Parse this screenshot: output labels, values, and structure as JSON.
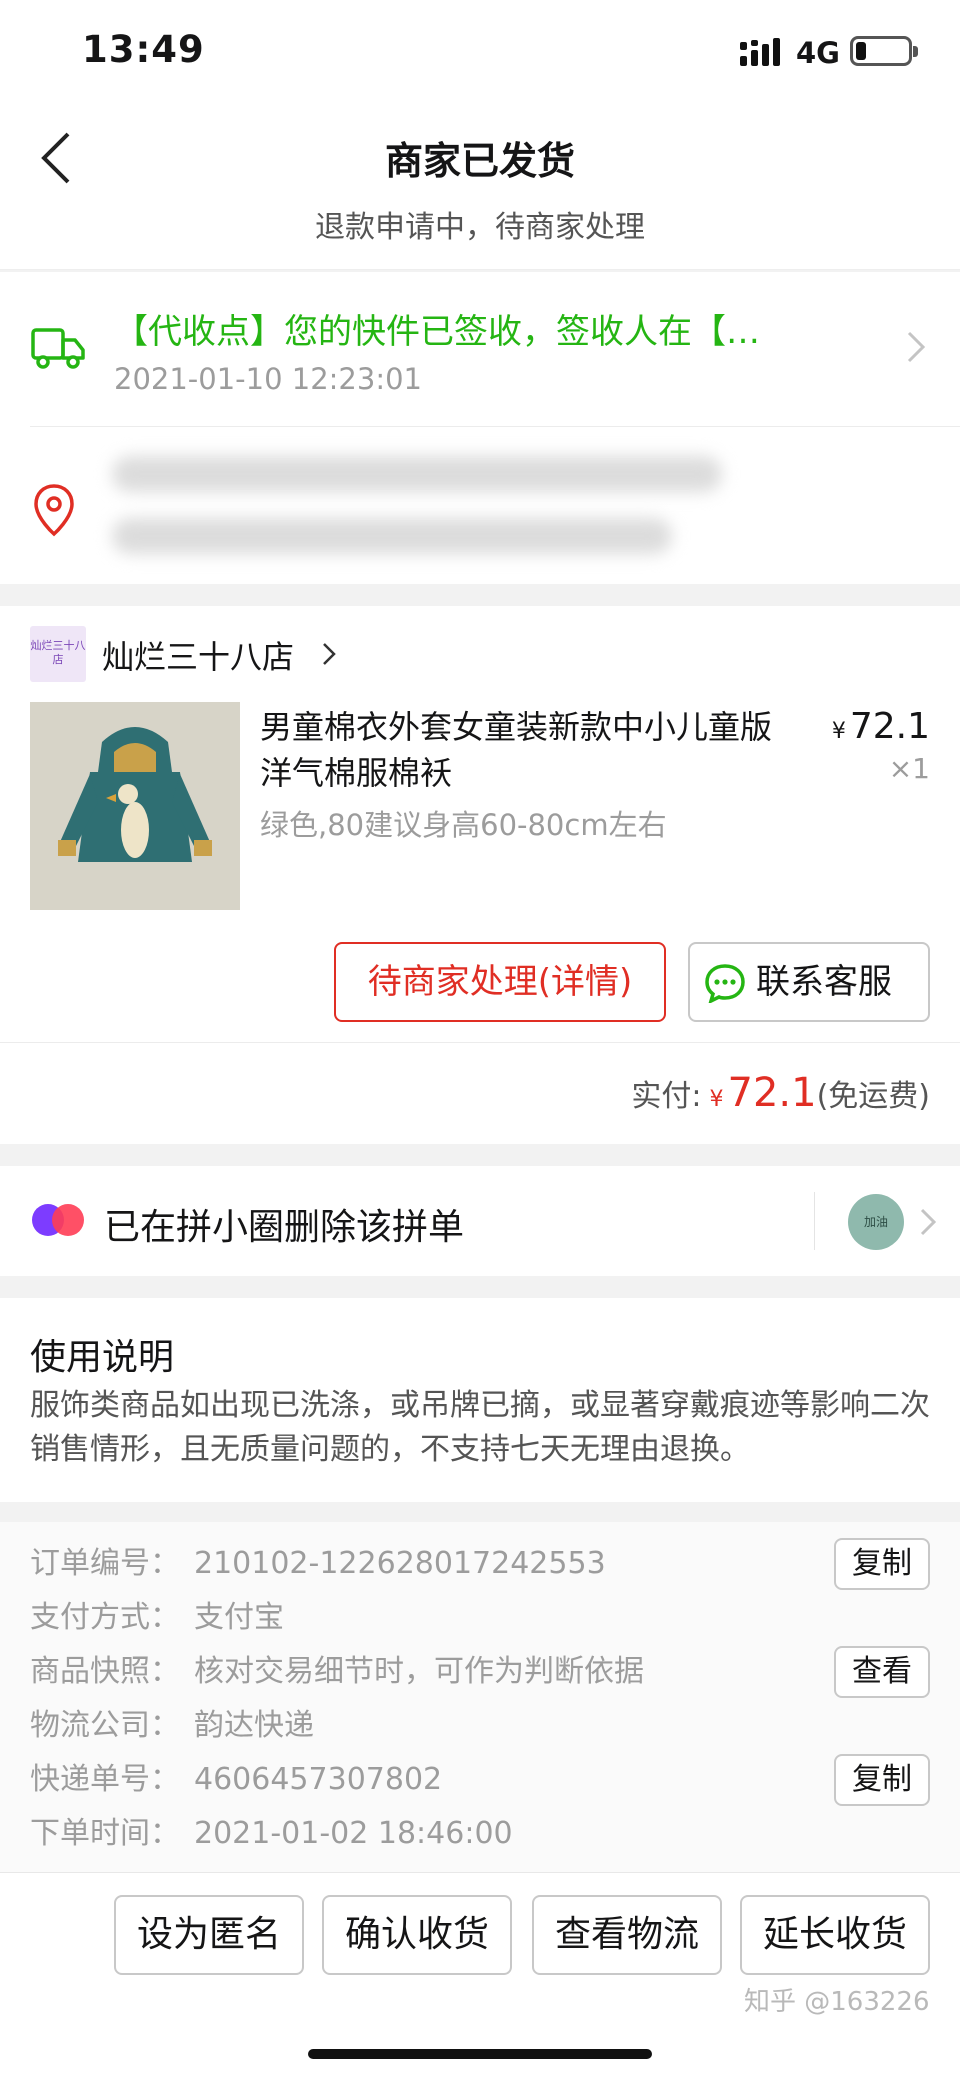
{
  "status_bar": {
    "time": "13:49",
    "network": "4G"
  },
  "nav": {
    "title": "商家已发货",
    "subtitle": "退款申请中，待商家处理"
  },
  "logistics": {
    "status_text": "【代收点】您的快件已签收，签收人在【…",
    "time": "2021-01-10 12:23:01"
  },
  "store": {
    "logo_text": "灿烂三十八店",
    "name": "灿烂三十八店"
  },
  "product": {
    "title": "男童棉衣外套女童装新款中小儿童版洋气棉服棉袄",
    "spec": "绿色,80建议身高60-80cm左右",
    "currency": "¥",
    "price": "72.1",
    "quantity": "×1"
  },
  "actions": {
    "pending_label": "待商家处理(详情)",
    "service_label": "联系客服"
  },
  "payment": {
    "label": "实付:",
    "currency": "¥",
    "amount": "72.1",
    "note": "(免运费)"
  },
  "circle": {
    "text": "已在拼小圈删除该拼单",
    "avatar_text": "加油"
  },
  "notes": {
    "title": "使用说明",
    "body": "服饰类商品如出现已洗涤，或吊牌已摘，或显著穿戴痕迹等影响二次销售情形，且无质量问题的，不支持七天无理由退换。"
  },
  "order_info": {
    "rows": [
      {
        "label": "订单编号：",
        "value": "210102-122628017242553",
        "button": "复制"
      },
      {
        "label": "支付方式：",
        "value": "支付宝"
      },
      {
        "label": "商品快照：",
        "value": "核对交易细节时，可作为判断依据",
        "button": "查看"
      },
      {
        "label": "物流公司：",
        "value": "韵达快递"
      },
      {
        "label": "快递单号：",
        "value": "4606457307802",
        "button": "复制"
      },
      {
        "label": "下单时间：",
        "value": "2021-01-02 18:46:00"
      }
    ]
  },
  "bottom_buttons": [
    "设为匿名",
    "确认收货",
    "查看物流",
    "延长收货"
  ],
  "watermark": "知乎 @163226",
  "colors": {
    "green": "#25b513",
    "red": "#e02e24"
  },
  "icons": [
    "back-arrow-icon",
    "signal-icon",
    "battery-icon",
    "truck-icon",
    "location-pin-icon",
    "chevron-right-icon",
    "chat-bubble-icon",
    "circle-logo-icon"
  ]
}
